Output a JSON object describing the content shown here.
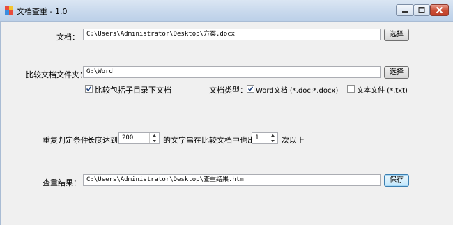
{
  "window": {
    "title": "文档查重 - 1.0"
  },
  "form": {
    "doc_label": "文档：",
    "doc_path": "C:\\Users\\Administrator\\Desktop\\方案.docx",
    "select_label_1": "选择",
    "compare_folder_label": "比较文档文件夹：",
    "compare_folder_path": "G:\\Word",
    "select_label_2": "选择",
    "include_subdir_label": "比较包括子目录下文档",
    "include_subdir_checked": true,
    "doc_type_label": "文档类型：",
    "word_type_label": "Word文档 (*.doc;*.docx)",
    "word_type_checked": true,
    "text_type_label": "文本文件 (*.txt)",
    "text_type_checked": false,
    "condition_label": "重复判定条件：",
    "length_label": "长度达到",
    "length_value": "200",
    "middle_text": "的文字串在比较文档中也出现",
    "times_value": "1",
    "times_suffix": "次以上",
    "result_label": "查重结果：",
    "result_path": "C:\\Users\\Administrator\\Desktop\\查重结果.htm",
    "save_label": "保存"
  }
}
